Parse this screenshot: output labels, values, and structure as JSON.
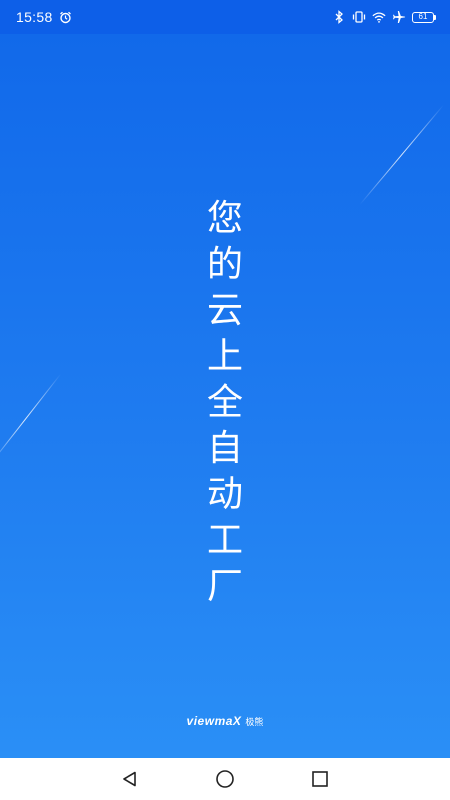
{
  "status_bar": {
    "time": "15:58",
    "battery_level": "61",
    "icons": [
      "alarm-icon",
      "bluetooth-icon",
      "vibrate-icon",
      "wifi-icon",
      "airplane-icon",
      "battery-icon"
    ]
  },
  "splash": {
    "slogan_chars": [
      "您",
      "的",
      "云",
      "上",
      "全",
      "自",
      "动",
      "工",
      "厂"
    ],
    "brand_logo_text": "viewmaX",
    "brand_cn": "极熊"
  },
  "nav_bar": {
    "buttons": [
      "back-button",
      "home-button",
      "recents-button"
    ]
  },
  "colors": {
    "status_bar_bg": "#0d5fe8",
    "gradient_top": "#1169ea",
    "gradient_bottom": "#2a8ff6",
    "text": "#ffffff",
    "nav_bg": "#ffffff",
    "nav_icon": "#222222"
  }
}
